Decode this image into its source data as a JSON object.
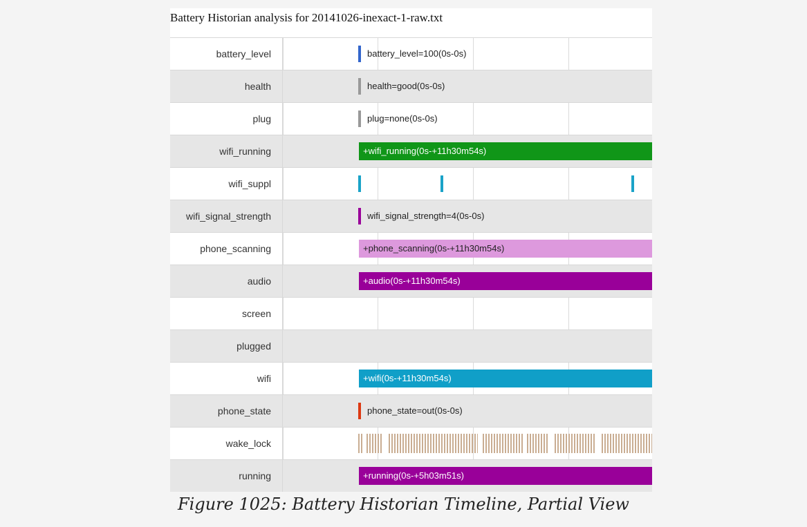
{
  "title": "Battery Historian analysis for 20141026-inexact-1-raw.txt",
  "caption": "Figure 1025: Battery Historian Timeline, Partial View",
  "rows": [
    {
      "label": "battery_level",
      "text": "battery_level=100(0s-0s)",
      "color": "#3366cc"
    },
    {
      "label": "health",
      "text": "health=good(0s-0s)",
      "color": "#999999"
    },
    {
      "label": "plug",
      "text": "plug=none(0s-0s)",
      "color": "#999999"
    },
    {
      "label": "wifi_running",
      "text": "+wifi_running(0s-+11h30m54s)",
      "color": "#109618"
    },
    {
      "label": "wifi_suppl",
      "color": "#1aa3c8"
    },
    {
      "label": "wifi_signal_strength",
      "text": "wifi_signal_strength=4(0s-0s)",
      "color": "#990099"
    },
    {
      "label": "phone_scanning",
      "text": "+phone_scanning(0s-+11h30m54s)",
      "color": "#dd99dd"
    },
    {
      "label": "audio",
      "text": "+audio(0s-+11h30m54s)",
      "color": "#990099"
    },
    {
      "label": "screen"
    },
    {
      "label": "plugged"
    },
    {
      "label": "wifi",
      "text": "+wifi(0s-+11h30m54s)",
      "color": "#109fc8"
    },
    {
      "label": "phone_state",
      "text": "phone_state=out(0s-0s)",
      "color": "#dc3912"
    },
    {
      "label": "wake_lock",
      "color": "#c9ad92"
    },
    {
      "label": "running",
      "text": "+running(0s-+5h03m51s)",
      "color": "#990099"
    }
  ]
}
